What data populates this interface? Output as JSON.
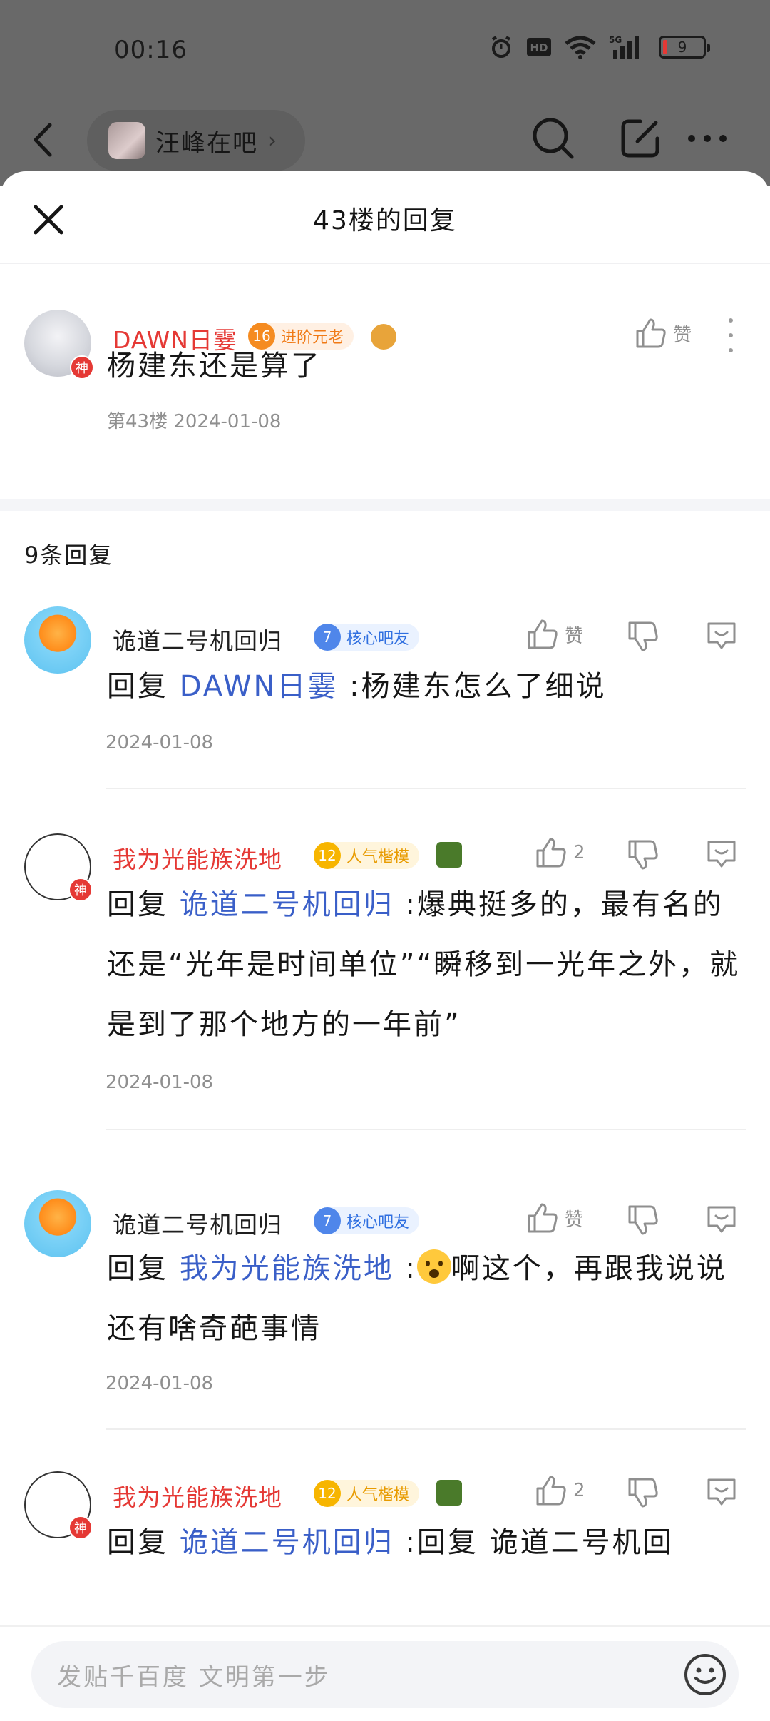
{
  "status_bar": {
    "time": "00:16",
    "battery": "9",
    "signal_label": "5G",
    "hd_label": "HD"
  },
  "top_nav": {
    "forum_name": "汪峰在吧",
    "chevron": "›"
  },
  "sheet": {
    "title": "43楼的回复"
  },
  "main_post": {
    "username": "DAWN日霎",
    "level": "16",
    "badge": "进阶元老",
    "shen": "神",
    "text": "杨建东还是算了",
    "meta": "第43楼  2024-01-08",
    "like_label": "赞"
  },
  "reply_count": "9条回复",
  "replies": [
    {
      "username": "诡道二号机回归",
      "level": "7",
      "badge": "核心吧友",
      "like": "赞",
      "prefix": "回复 ",
      "target": "DAWN日霎",
      "content": " :杨建东怎么了细说",
      "date": "2024-01-08"
    },
    {
      "username": "我为光能族洗地",
      "level": "12",
      "badge": "人气楷模",
      "shen": "神",
      "like": "2",
      "prefix": "回复 ",
      "target": "诡道二号机回归",
      "content": " :爆典挺多的，最有名的还是“光年是时间单位”“瞬移到一光年之外，就是到了那个地方的一年前”",
      "date": "2024-01-08"
    },
    {
      "username": "诡道二号机回归",
      "level": "7",
      "badge": "核心吧友",
      "like": "赞",
      "prefix": "回复 ",
      "target": "我为光能族洗地",
      "content_before": " :",
      "content_after": "啊这个，再跟我说说还有啥奇葩事情",
      "date": "2024-01-08"
    },
    {
      "username": "我为光能族洗地",
      "level": "12",
      "badge": "人气楷模",
      "shen": "神",
      "like": "2",
      "prefix": "回复 ",
      "target": "诡道二号机回归",
      "content": " :回复 诡道二号机回"
    }
  ],
  "bottom_bar": {
    "placeholder": "发贴千百度 文明第一步"
  },
  "colors": {
    "link": "#3a5fc8",
    "username_red": "#e53935",
    "meta_gray": "#8f8f8f"
  }
}
